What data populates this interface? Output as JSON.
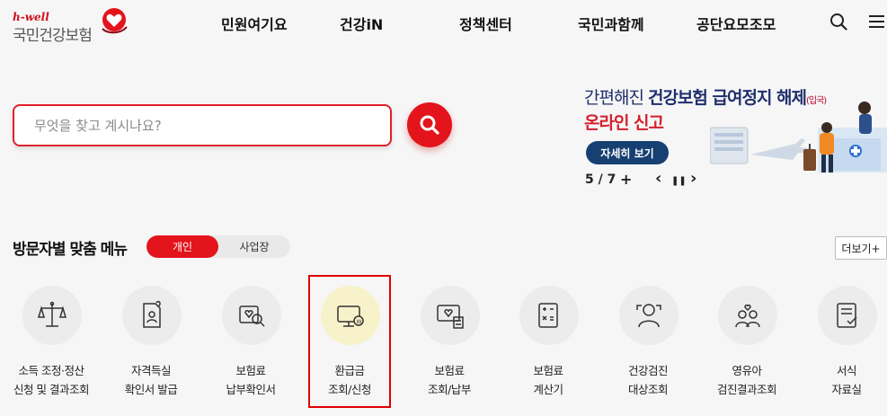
{
  "header": {
    "logo_sub": "h-well",
    "logo_main": "국민건강보험",
    "nav": [
      "민원여기요",
      "건강iN",
      "정책센터",
      "국민과함께",
      "공단요모조모"
    ],
    "icons": [
      "search-icon",
      "hamburger-menu-icon"
    ]
  },
  "search": {
    "placeholder": "무엇을 찾고 계시나요?"
  },
  "banner": {
    "line1_light": "간편해진 ",
    "line1_bold": "건강보험 급여정지 해제",
    "line1_small": "(입국)",
    "line2": "온라인 신고",
    "detail_button": "자세히 보기",
    "counter": "5 / 7",
    "controls": [
      "+",
      "‹",
      "❚❚",
      "›"
    ]
  },
  "custom_menu": {
    "title": "방문자별 맞춤 메뉴",
    "toggle_active": "개인",
    "toggle_inactive": "사업장",
    "more_button": "더보기+",
    "items": [
      {
        "line1": "소득 조정·정산",
        "line2": "신청 및 결과조회",
        "icon": "scale-icon"
      },
      {
        "line1": "자격득실",
        "line2": "확인서 발급",
        "icon": "certificate-icon"
      },
      {
        "line1": "보험료",
        "line2": "납부확인서",
        "icon": "payment-confirm-icon"
      },
      {
        "line1": "환급금",
        "line2": "조회/신청",
        "icon": "refund-monitor-icon"
      },
      {
        "line1": "보험료",
        "line2": "조회/납부",
        "icon": "premium-inquiry-icon"
      },
      {
        "line1": "보험료",
        "line2": "계산기",
        "icon": "calculator-icon"
      },
      {
        "line1": "건강검진",
        "line2": "대상조회",
        "icon": "checkup-person-icon"
      },
      {
        "line1": "영유아",
        "line2": "검진결과조회",
        "icon": "infant-checkup-icon"
      },
      {
        "line1": "서식",
        "line2": "자료실",
        "icon": "form-document-icon"
      }
    ]
  },
  "colors": {
    "brand_red": "#e3141c",
    "navy": "#1f2f6b",
    "button_navy": "#163f72",
    "highlight_circle": "#f7f2c9",
    "highlight_frame": "#e00000"
  }
}
